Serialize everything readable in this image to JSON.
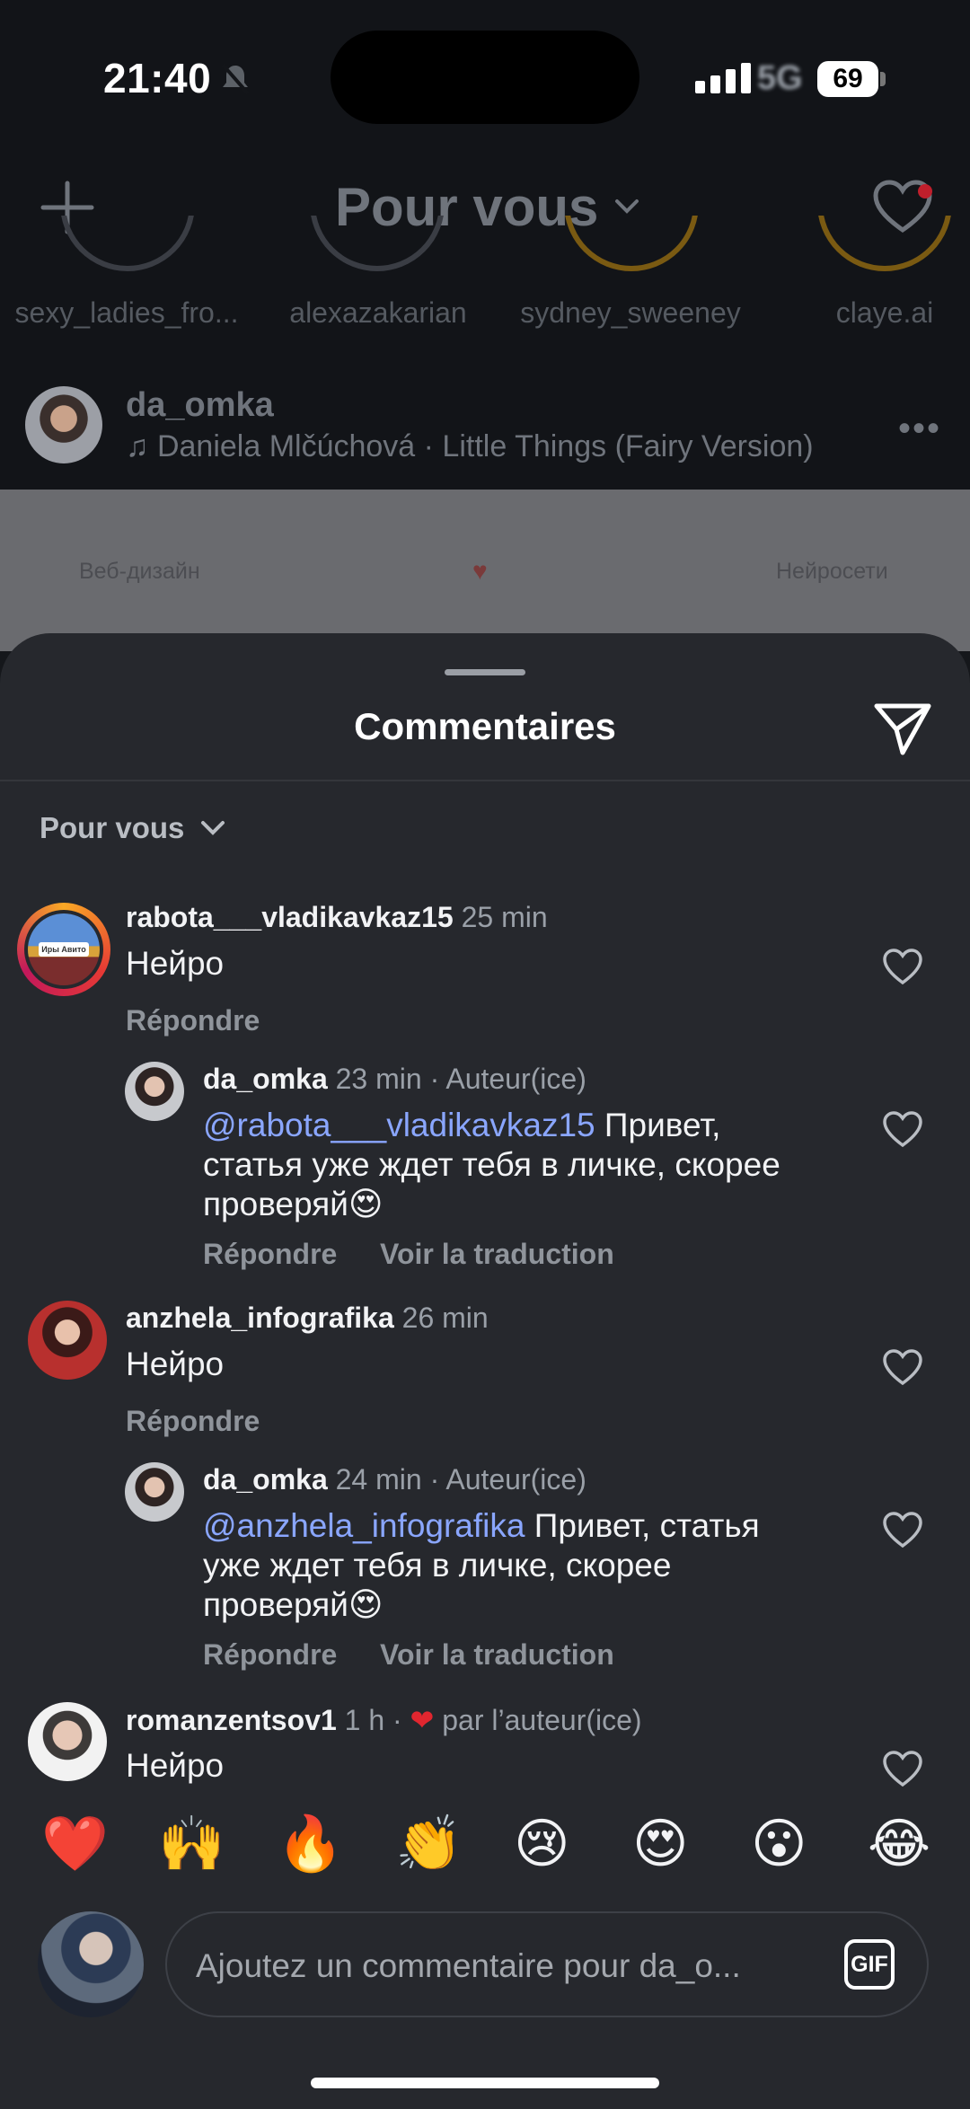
{
  "status_bar": {
    "time": "21:40",
    "network": "5G",
    "battery": "69"
  },
  "feed_header": {
    "title": "Pour vous"
  },
  "stories": [
    {
      "name": "sexy_ladies_fro...",
      "ring": "#3a3d44"
    },
    {
      "name": "alexazakarian",
      "ring": "#3a3d44"
    },
    {
      "name": "sydney_sweeney",
      "ring": "#7a5a12"
    },
    {
      "name": "claye.ai",
      "ring": "#7a5a12"
    }
  ],
  "post": {
    "username": "da_omka",
    "music": "Daniela Mlčúchová · Little Things (Fairy Version)",
    "image_label_left": "Веб-дизайн",
    "image_label_right": "Нейросети"
  },
  "sheet": {
    "title": "Commentaires",
    "filter": "Pour vous"
  },
  "comments": [
    {
      "user": "rabota___vladikavkaz15",
      "time": "25 min",
      "text": "Нейро",
      "reply": "Répondre",
      "avatar_badge": "Иры Авито"
    },
    {
      "user": "da_omka",
      "time": "23 min · Auteur(ice)",
      "mention": "@rabota___vladikavkaz15",
      "text_line1": " Привет,",
      "text_line2": "статья уже ждет тебя в личке, скорее",
      "text_line3": "проверяй😍",
      "reply": "Répondre",
      "translate": "Voir la traduction"
    },
    {
      "user": "anzhela_infografika",
      "time": "26 min",
      "text": "Нейро",
      "reply": "Répondre"
    },
    {
      "user": "da_omka",
      "time": "24 min · Auteur(ice)",
      "mention": "@anzhela_infografika",
      "text_line1": " Привет, статья",
      "text_line2": "уже ждет тебя в личке, скорее",
      "text_line3": "проверяй😍",
      "reply": "Répondre",
      "translate": "Voir la traduction"
    },
    {
      "user": "romanzentsov1",
      "time": "1 h ·",
      "liked_by_author": "par l’auteur(ice)",
      "text": "Нейро"
    }
  ],
  "quick_emojis": [
    "❤️",
    "🙌",
    "🔥",
    "👏",
    "😢",
    "😍",
    "😮",
    "😂"
  ],
  "composer": {
    "placeholder": "Ajoutez un commentaire pour da_o...",
    "gif_label": "GIF"
  },
  "colors": {
    "accent_link": "#8aa6ff",
    "sheet_bg": "#26282d",
    "like_red": "#e0262f"
  }
}
